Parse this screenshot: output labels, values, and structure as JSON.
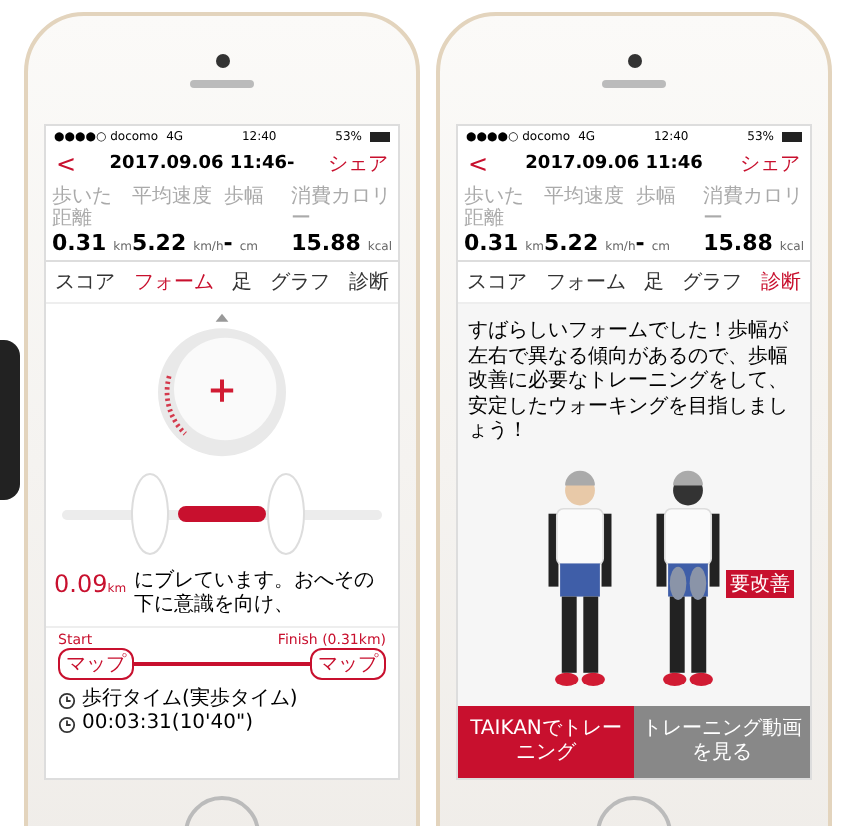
{
  "phones": [
    {
      "kind": "form",
      "status_bar": {
        "carrier": "●●●●○ docomo",
        "network": "4G",
        "time": "12:40",
        "battery": "53%"
      },
      "header": {
        "back": "<",
        "title": "2017.09.06 11:46-",
        "action": "シェア"
      },
      "stats": [
        {
          "label": "歩いた距離",
          "value": "0.31",
          "unit": "km"
        },
        {
          "label": "平均速度",
          "value": "5.22",
          "unit": "km/h"
        },
        {
          "label": "歩幅",
          "value": "-",
          "unit": "cm"
        },
        {
          "label": "消費カロリー",
          "value": "15.88",
          "unit": "kcal"
        }
      ],
      "tabs": [
        {
          "label": "スコア",
          "selected": false
        },
        {
          "label": "フォーム",
          "selected": true
        },
        {
          "label": "足",
          "selected": false
        },
        {
          "label": "グラフ",
          "selected": false
        },
        {
          "label": "診断",
          "selected": false
        }
      ],
      "form": {
        "distance": "0.09",
        "distance_unit": "km",
        "message": "にブレています。おへその下に意識を向け、",
        "start_label": "Start",
        "finish_label": "Finish (0.31km)",
        "start_tag": "マップ",
        "finish_tag": "マップ",
        "time_label": "歩行タイム(実歩タイム)",
        "time_value": "00:03:31(10'40\")"
      }
    },
    {
      "kind": "diagnosis",
      "status_bar": {
        "carrier": "●●●●○ docomo",
        "network": "4G",
        "time": "12:40",
        "battery": "53%"
      },
      "header": {
        "back": "<",
        "title": "2017.09.06 11:46",
        "action": "シェア"
      },
      "stats": [
        {
          "label": "歩いた距離",
          "value": "0.31",
          "unit": "km"
        },
        {
          "label": "平均速度",
          "value": "5.22",
          "unit": "km/h"
        },
        {
          "label": "歩幅",
          "value": "-",
          "unit": "cm"
        },
        {
          "label": "消費カロリー",
          "value": "15.88",
          "unit": "kcal"
        }
      ],
      "tabs": [
        {
          "label": "スコア",
          "selected": false
        },
        {
          "label": "フォーム",
          "selected": false
        },
        {
          "label": "足",
          "selected": false
        },
        {
          "label": "グラフ",
          "selected": false
        },
        {
          "label": "診断",
          "selected": true
        }
      ],
      "diagnosis": {
        "message": "すばらしいフォームでした！歩幅が左右で異なる傾向があるので、歩幅改善に必要なトレーニングをして、安定したウォーキングを目指しましょう！",
        "marker": "要改善",
        "buttons": [
          {
            "label": "TAIKANでトレーニング",
            "kind": "primary"
          },
          {
            "label": "トレーニング動画を見る",
            "kind": "secondary"
          }
        ]
      }
    }
  ]
}
